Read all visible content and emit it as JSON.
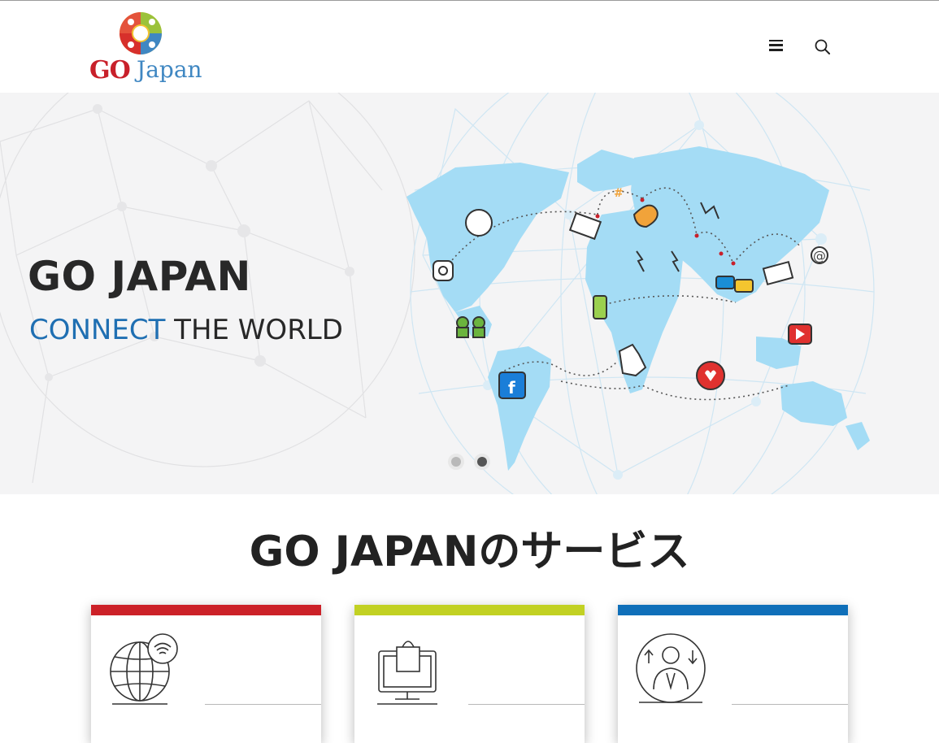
{
  "header": {
    "logo": {
      "go": "GO",
      "japan": "Japan",
      "alt": "GO Japan"
    },
    "menu_icon": "hamburger-menu-icon",
    "search_icon": "search-icon"
  },
  "hero": {
    "title": "GO JAPAN",
    "subtitle_accent": "CONNECT",
    "subtitle_rest": " THE WORLD",
    "slides": 2,
    "active_slide": 2,
    "colors": {
      "accent": "#1f6fb2",
      "map": "#a4dcf5"
    }
  },
  "services": {
    "title": "GO JAPANのサービス",
    "cards": [
      {
        "color": "#cc2128",
        "icon": "globe-wifi-icon"
      },
      {
        "color": "#c2d123",
        "icon": "online-shopping-icon"
      },
      {
        "color": "#0f6fb9",
        "icon": "person-growth-icon"
      }
    ]
  }
}
